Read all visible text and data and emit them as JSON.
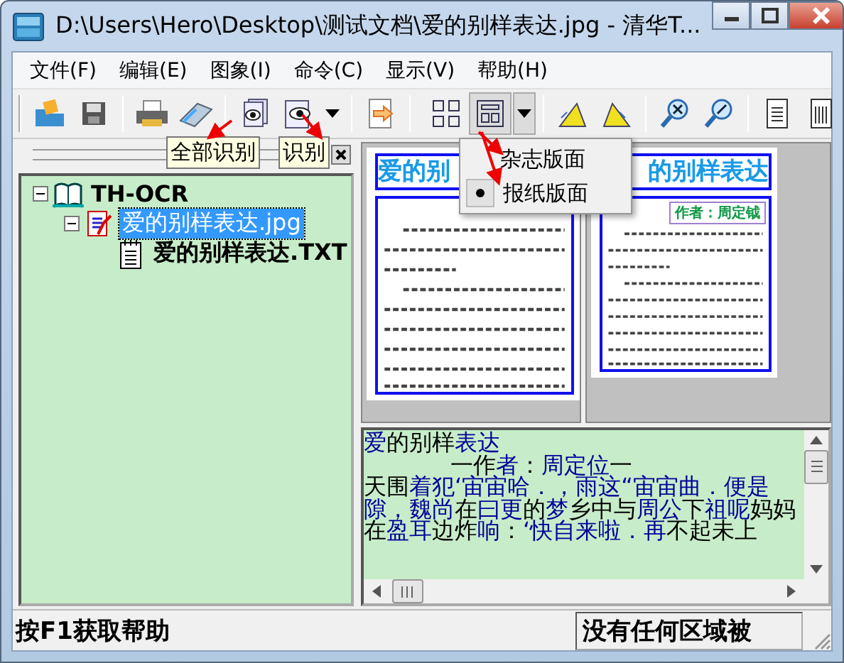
{
  "window": {
    "title": "D:\\Users\\Hero\\Desktop\\测试文档\\爱的别样表达.jpg - 清华T..."
  },
  "menu_bar": [
    "文件(F)",
    "编辑(E)",
    "图象(I)",
    "命令(C)",
    "显示(V)",
    "帮助(H)"
  ],
  "tooltips": [
    "全部识别",
    "识别"
  ],
  "tree": [
    {
      "label": "TH-OCR",
      "kind": "project",
      "expanded": true,
      "selected": false,
      "children": [
        {
          "label": "爱的别样表达.jpg",
          "kind": "image",
          "expanded": true,
          "selected": true,
          "children": [
            {
              "label": "爱的别样表达.TXT",
              "kind": "text",
              "selected": false
            }
          ]
        }
      ]
    }
  ],
  "preview_pages": [
    {
      "title": "爱的别"
    },
    {
      "title": "的别样表达",
      "author": "作者：周定钺"
    }
  ],
  "layout_menu": [
    {
      "label": "杂志版面",
      "checked": false
    },
    {
      "label": "报纸版面",
      "checked": true
    }
  ],
  "recognized_text": [
    [
      {
        "text": "爱",
        "color": "#000099"
      },
      {
        "text": "的别样",
        "color": "#000000"
      },
      {
        "text": "表达",
        "color": "#000099"
      }
    ],
    [
      {
        "text": "            一作",
        "color": "#000000"
      },
      {
        "text": "者",
        "color": "#000099"
      },
      {
        "text": "：",
        "color": "#000000"
      },
      {
        "text": "周定位",
        "color": "#000099"
      },
      {
        "text": "一",
        "color": "#000000"
      }
    ],
    [
      {
        "text": "天围",
        "color": "#000000"
      },
      {
        "text": "着犯‘宙宙哈．，雨这“宙宙曲．便是",
        "color": "#000099"
      }
    ],
    [
      {
        "text": "隙，魏尚",
        "color": "#000099"
      },
      {
        "text": "在",
        "color": "#000000"
      },
      {
        "text": "曰更",
        "color": "#000099"
      },
      {
        "text": "的",
        "color": "#000000"
      },
      {
        "text": "梦",
        "color": "#000099"
      },
      {
        "text": "乡中与",
        "color": "#000000"
      },
      {
        "text": "周公",
        "color": "#000099"
      },
      {
        "text": "下",
        "color": "#000000"
      },
      {
        "text": "祖呢",
        "color": "#000099"
      },
      {
        "text": "妈妈",
        "color": "#000000"
      }
    ],
    [
      {
        "text": "在",
        "color": "#000000"
      },
      {
        "text": "盈耳",
        "color": "#000099"
      },
      {
        "text": "边炸",
        "color": "#000000"
      },
      {
        "text": "响",
        "color": "#000099"
      },
      {
        "text": "：",
        "color": "#000000"
      },
      {
        "text": "‘快自来啦．再",
        "color": "#000099"
      },
      {
        "text": "不起未上",
        "color": "#000000"
      }
    ]
  ],
  "status_bar": [
    "按F1获取帮助",
    "没有任何区域被"
  ]
}
